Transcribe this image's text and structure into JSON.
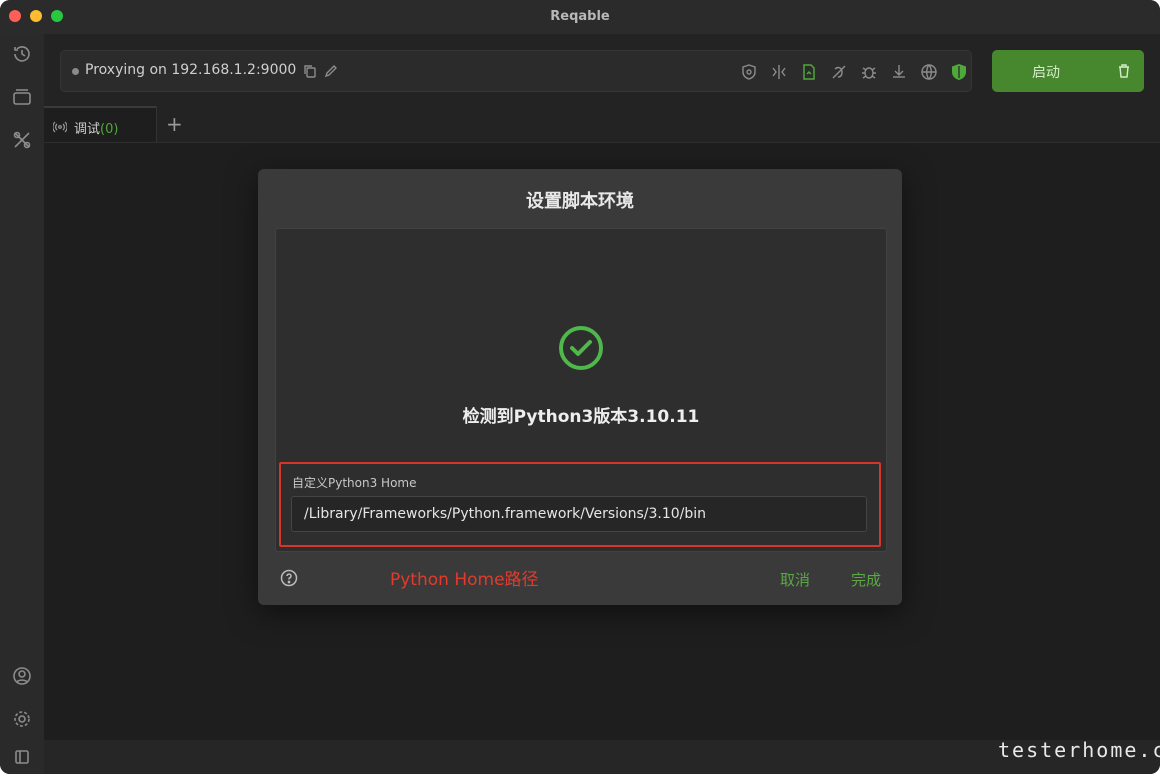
{
  "window": {
    "title": "Reqable"
  },
  "sidebar": {
    "icons": [
      "history-icon",
      "layers-icon",
      "tools-icon",
      "account-icon",
      "settings-icon",
      "panel-toggle-icon"
    ]
  },
  "proxy": {
    "status_text": "Proxying on 192.168.1.2:9000"
  },
  "toolbar": {
    "icons": [
      "ssl-lock-icon",
      "rewrite-icon",
      "script-icon",
      "breakpoint-icon",
      "debug-icon",
      "download-icon",
      "network-icon",
      "shield-icon"
    ],
    "start_label": "启动"
  },
  "tabs": [
    {
      "label": "调试",
      "count": "(0)"
    }
  ],
  "add_tab_label": "+",
  "dialog": {
    "title": "设置脚本环境",
    "detect_text": "检测到Python3版本3.10.11",
    "home_label": "自定义Python3 Home",
    "home_value": "/Library/Frameworks/Python.framework/Versions/3.10/bin",
    "annotation": "Python Home路径",
    "cancel_label": "取消",
    "done_label": "完成"
  },
  "watermark": "testerhome.com",
  "colors": {
    "accent_green": "#5aa844",
    "start_button": "#47882f",
    "annotation_red": "#e23a2c"
  }
}
